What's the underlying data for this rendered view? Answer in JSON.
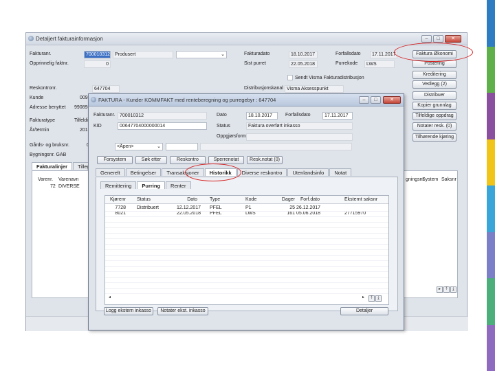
{
  "main_window": {
    "title": "Detaljert fakturainformasjon",
    "labels": {
      "fakturanr": "Fakturanr.",
      "opprinnelig": "Opprinnelig faktnr.",
      "reskontronr": "Reskontronr.",
      "kunde": "Kunde",
      "adresse": "Adresse benyttet",
      "fakturatype": "Fakturatype",
      "ar_termin": "År/termin",
      "gards": "Gårds- og bruksnr.",
      "bygning": "Bygningsnr. GAB",
      "fakturadato": "Fakturadato",
      "sist_purret": "Sist purret",
      "forfallsdato": "Forfallsdato",
      "purrekode": "Purrekode",
      "distribusjonskanal": "Distribusjonskanal",
      "sendt_visma": "Sendt Visma Fakturadistribusjon"
    },
    "values": {
      "fakturanr": "700010312",
      "status": "Produsert",
      "opprinnelig": "0",
      "reskontronr": "647704",
      "kunde_partial": "009",
      "adresse_partial": "990898",
      "fakturatype_partial": "Tilfeldig",
      "ar_partial": "2017",
      "gards_partial": "0",
      "fakturadato": "18.10.2017",
      "sist_purret": "22.05.2018",
      "forfallsdato": "17.11.2017",
      "purrekode": "LWS",
      "distribusjonskanal": "Visma Aksesspunkt"
    },
    "side_buttons": [
      "Faktura Økonomi",
      "Postering",
      "Kreditering",
      "Vedlegg (2)",
      "Distribuer",
      "Kopier grunnlag",
      "Tilfeldige oppdrag",
      "Notater resk. (0)",
      "Tilhørende kjøring"
    ],
    "tabs": [
      "Fakturalinjer",
      "Tillegg"
    ],
    "lines_header": {
      "varenr": "Varenr.",
      "varenavn": "Varenavn",
      "gningsnr": "gningsnr",
      "system": "System",
      "saksnr": "Saksnr"
    },
    "lines_row": {
      "varenr": "72",
      "varenavn": "DIVERSE"
    }
  },
  "dialog": {
    "title": "FAKTURA - Kunder KOMMFAKT med renteberegning og purregebyr : 647704",
    "labels": {
      "fakturanr": "Fakturanr.",
      "kid": "KID",
      "dato": "Dato",
      "forfallsdato": "Forfallsdato",
      "status": "Status",
      "oppgjorsform": "Oppgjørsform"
    },
    "values": {
      "fakturanr": "700010312",
      "kid": "00647704000000014",
      "dato": "18.10.2017",
      "forfallsdato": "17.11.2017",
      "status": "Faktura overført inkasso",
      "apen": "<Åpen>"
    },
    "buttons": [
      "Forsystem",
      "Søk etter",
      "Reskontro",
      "Sperrenotat",
      "Resk.notat (0)"
    ],
    "tabs": [
      "Generelt",
      "Betingelser",
      "Transaksjoner",
      "Historikk",
      "Diverse reskontro",
      "Utenlandsinfo",
      "Notat"
    ],
    "subtabs": [
      "Remittering",
      "Purring",
      "Renter"
    ],
    "table": {
      "headers": [
        "Kjørenr",
        "Status",
        "Dato",
        "Type",
        "Kode",
        "Dager",
        "Forf.dato",
        "Eksternt saksnr"
      ],
      "rows": [
        [
          "7728",
          "Distribuert",
          "12.12.2017",
          "PFEL",
          "P1",
          "25",
          "26.12.2017",
          ""
        ],
        [
          "8021",
          "",
          "22.05.2018",
          "PFEL",
          "LWS",
          "161",
          "05.06.2018",
          "27715970"
        ]
      ]
    },
    "bottom_buttons": [
      "Logg ekstern inkasso",
      "Notater ekst. inkasso",
      "Detaljer"
    ]
  },
  "colors": {
    "highlight_oval": "#d61f1f",
    "stripes": [
      "#2e7cc2",
      "#5fb04a",
      "#8a4f9e",
      "#f0c419",
      "#3aa5d8",
      "#7a7fc7",
      "#4cae7a",
      "#8f6bbf"
    ]
  }
}
